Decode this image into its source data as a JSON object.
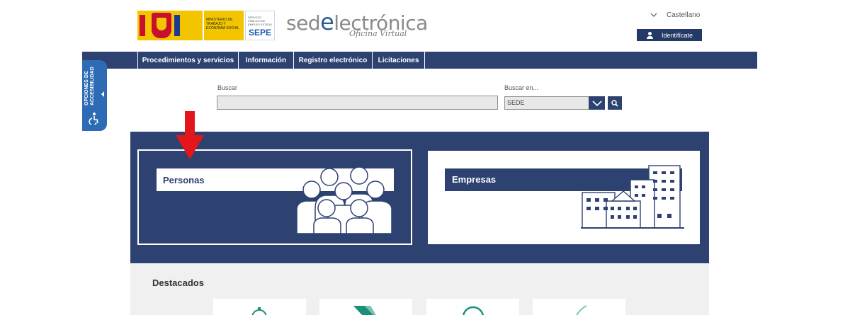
{
  "header": {
    "gov_logo_text": "GOBIERNO DE ESPAÑA",
    "ministry_text": "MINISTERIO DE TRABAJO Y ECONOMÍA SOCIAL",
    "sepe_small_text": "SERVICIO PÚBLICO DE EMPLEO ESTATAL",
    "sepe_label": "SEPE",
    "site_title_prefix": "sed",
    "site_title_letter": "e",
    "site_title_suffix": "lectrónica",
    "site_subtitle": "Oficina Virtual",
    "language": "Castellano",
    "identify_button": "Identifícate"
  },
  "nav": {
    "items": [
      {
        "label": "Procedimientos y servicios"
      },
      {
        "label": "Información"
      },
      {
        "label": "Registro electrónico"
      },
      {
        "label": "Licitaciones"
      }
    ]
  },
  "accessibility": {
    "label": "OPCIONES DE ACCESIBILIDAD"
  },
  "search": {
    "label": "Buscar",
    "value": "",
    "scope_label": "Buscar en...",
    "scope_selected": "SEDE"
  },
  "cards": {
    "personas": "Personas",
    "empresas": "Empresas"
  },
  "featured": {
    "title": "Destacados"
  },
  "colors": {
    "brand_navy": "#2d4271",
    "accent_blue": "#2d6cb5",
    "highlight_red": "#e3161b",
    "featured_teal": "#1b8f7a"
  }
}
